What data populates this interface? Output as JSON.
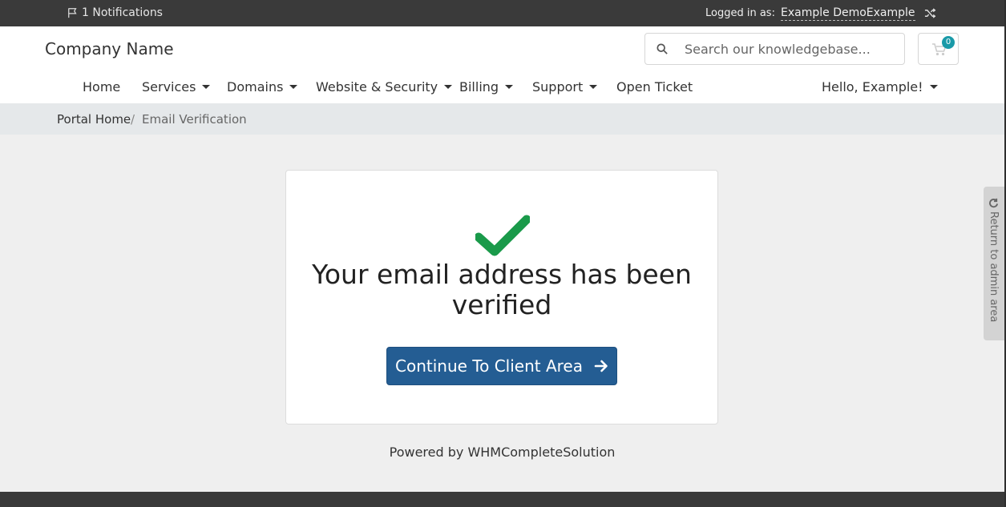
{
  "topbar": {
    "notifications": "1 Notifications",
    "logged_in_label": "Logged in as:",
    "user": "Example DemoExample"
  },
  "header": {
    "brand": "Company Name",
    "search_placeholder": "Search our knowledgebase...",
    "cart_count": "0"
  },
  "nav": {
    "items": [
      {
        "label": "Home"
      },
      {
        "label": "Services"
      },
      {
        "label": "Domains"
      },
      {
        "label": "Website & Security"
      },
      {
        "label": "Billing"
      },
      {
        "label": "Support"
      },
      {
        "label": "Open Ticket"
      }
    ],
    "account": "Hello, Example!"
  },
  "breadcrumb": {
    "home": "Portal Home",
    "separator": "/",
    "current": "Email Verification"
  },
  "main": {
    "heading": "Your email address has been verified",
    "button": "Continue To Client Area",
    "powered_prefix": "Powered by",
    "powered_link": "WHMCompleteSolution"
  },
  "sidetab": {
    "label": "Return to admin area"
  },
  "colors": {
    "topbar": "#3a3a3a",
    "primary_button": "#245d93",
    "check": "#1a9a4a",
    "badge": "#1a9aa8"
  }
}
